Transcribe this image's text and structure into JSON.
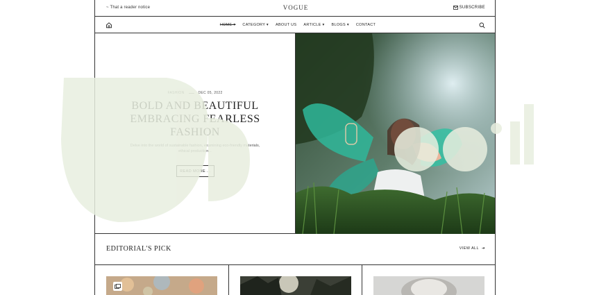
{
  "topbar": {
    "notice": "~ That a reader notice",
    "brand": "VOGUE",
    "subscribe_label": "SUBSCRIBE",
    "subscribe_icon": "mail-icon"
  },
  "nav": {
    "home_icon": "home-icon",
    "items": [
      {
        "label": "HOME",
        "has_dropdown": true,
        "active": true
      },
      {
        "label": "CATEGORY",
        "has_dropdown": true
      },
      {
        "label": "ABOUT US",
        "has_dropdown": false
      },
      {
        "label": "ARTICLE",
        "has_dropdown": true
      },
      {
        "label": "BLOGS",
        "has_dropdown": true
      },
      {
        "label": "CONTACT",
        "has_dropdown": false
      }
    ],
    "dropdown_glyph": "▾",
    "search_icon": "search-icon"
  },
  "hero": {
    "category": "FASHION",
    "date": "DEC 05, 2022",
    "title": "BOLD AND BEAUTIFUL EMBRACING FEARLESS FASHION",
    "description": "Delve into the world of sustainable fashion, examining eco-friendly materials, ethical production...",
    "button_label": "READ MORE ...",
    "image": "fairy-in-meadow-photo"
  },
  "editorial": {
    "title": "EDITORIAL'S PICK",
    "view_all_label": "VIEW ALL",
    "arrow_glyph": "➔"
  },
  "cards": [
    {
      "image": "bokeh-photo",
      "badge_icon": "gallery-icon"
    },
    {
      "image": "forest-sunlight-photo"
    },
    {
      "image": "portrait-photo"
    }
  ],
  "colors": {
    "watermark": "#e8eedf",
    "border": "#333333",
    "text": "#222222"
  }
}
